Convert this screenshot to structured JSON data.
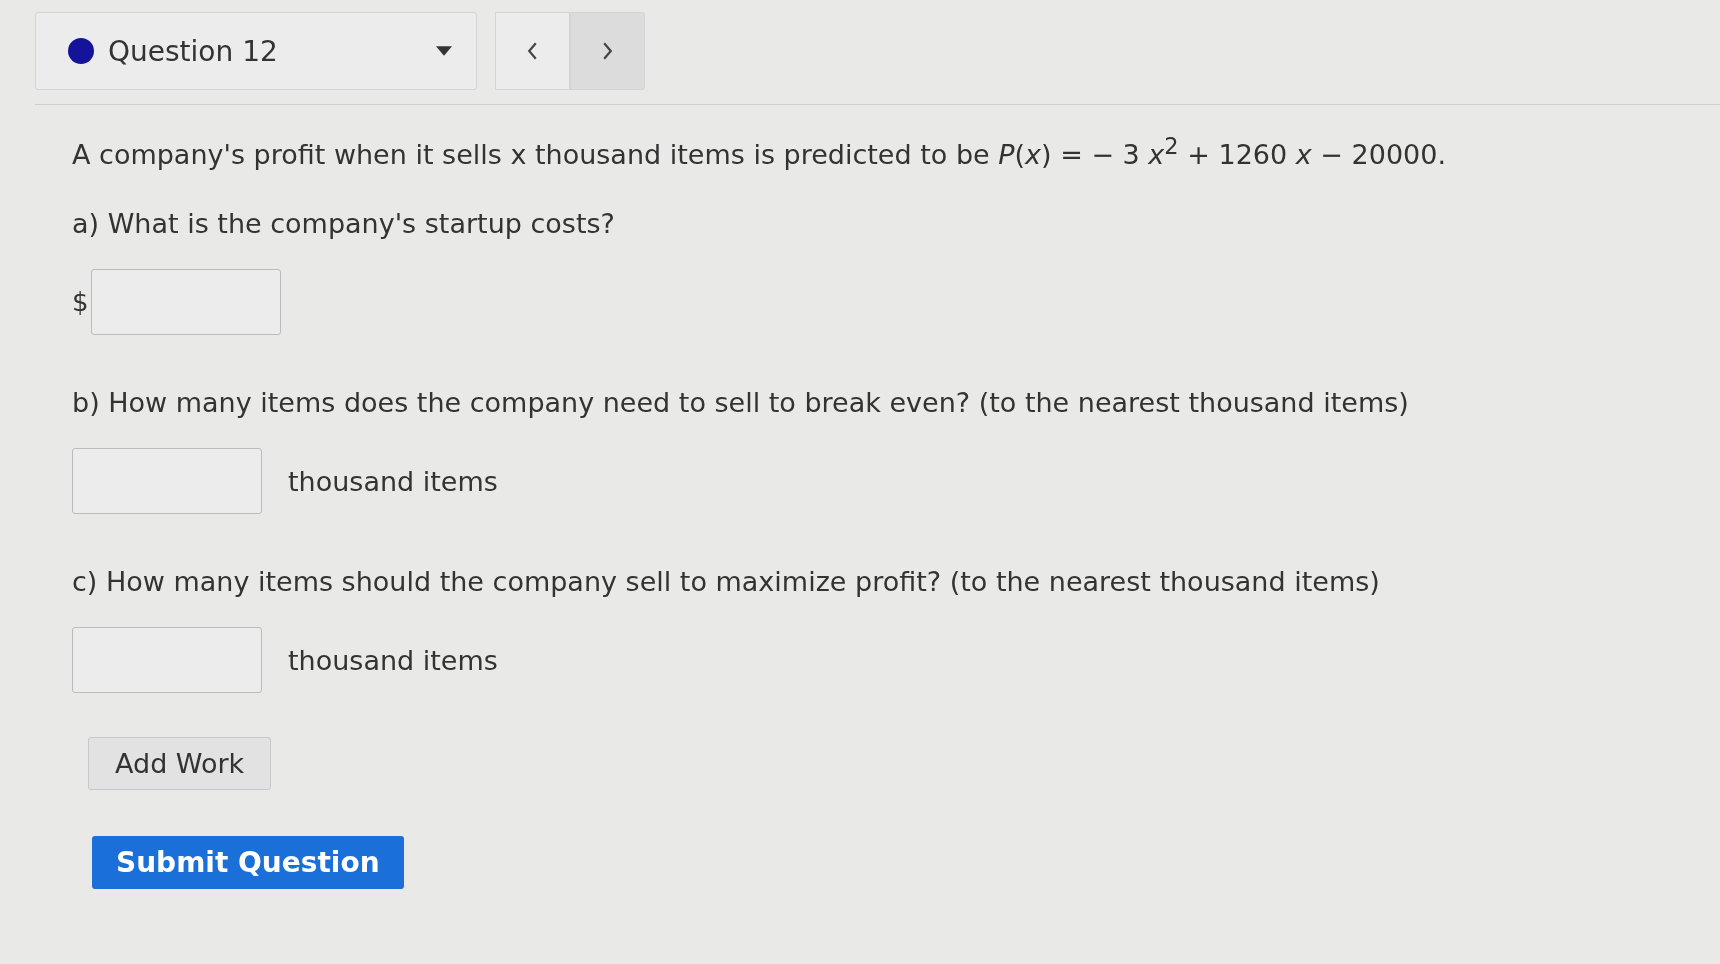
{
  "question_menu": {
    "label": "Question 12"
  },
  "intro": "A company's profit when it sells x thousand items is predicted to be *P*(*x*) = − 3 *x*$^{2}$ + 1260 *x* − 20000.",
  "parts": [
    {
      "kind": "prefix",
      "prompt": "a) What is the company's startup costs?",
      "unit": "$"
    },
    {
      "kind": "suffix",
      "prompt": "b) How many items does the company need to sell to break even? (to the nearest thousand items)",
      "unit": "thousand items"
    },
    {
      "kind": "suffix",
      "prompt": "c) How many items should the company sell to maximize profit? (to the nearest thousand items)",
      "unit": "thousand items"
    }
  ],
  "add_work": "Add Work",
  "submit": "Submit Question"
}
